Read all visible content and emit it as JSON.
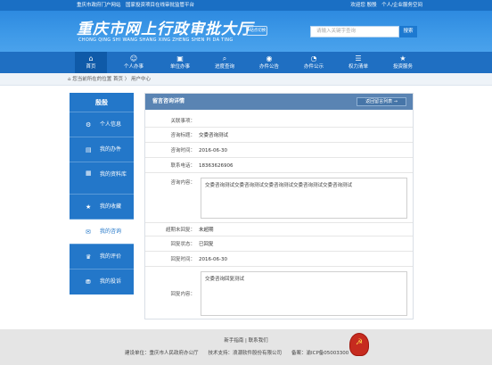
{
  "topbar": {
    "left_text": "重庆市政府门户网站　国家投资项目在线审批监管平台",
    "right_text": "欢迎您 殷殷　个人/企业服务空间"
  },
  "banner": {
    "title": "重庆市网上行政审批大厅",
    "subtitle": "CHONG QING SHI WANG SHANG XING ZHENG SHEN PI DA TING",
    "switch_label": "站点切换",
    "search_placeholder": "请输入关键字查询",
    "search_button": "搜索"
  },
  "nav": [
    {
      "label": "首页",
      "icon": "home-icon",
      "glyph": "⌂"
    },
    {
      "label": "个人办事",
      "icon": "person-icon",
      "glyph": "☺"
    },
    {
      "label": "单位办事",
      "icon": "briefcase-icon",
      "glyph": "▣"
    },
    {
      "label": "进度查询",
      "icon": "search-icon",
      "glyph": "⌕"
    },
    {
      "label": "办件公告",
      "icon": "announcement-icon",
      "glyph": "◉"
    },
    {
      "label": "办件公示",
      "icon": "chat-icon",
      "glyph": "◔"
    },
    {
      "label": "权力清单",
      "icon": "list-icon",
      "glyph": "☰"
    },
    {
      "label": "投资服务",
      "icon": "star-icon",
      "glyph": "★"
    }
  ],
  "breadcrumb": {
    "prefix": "您当前所在的位置",
    "path": "首页 〉 用户中心"
  },
  "sidebar": {
    "user": "殷殷",
    "items": [
      {
        "label": "个人信息",
        "icon": "gear-icon",
        "glyph": "⚙"
      },
      {
        "label": "我的办件",
        "icon": "document-icon",
        "glyph": "▤"
      },
      {
        "label": "我的资料库",
        "icon": "folder-icon",
        "glyph": "▦"
      },
      {
        "label": "我的收藏",
        "icon": "star-icon",
        "glyph": "★"
      },
      {
        "label": "我的咨询",
        "icon": "chat-icon",
        "glyph": "✉"
      },
      {
        "label": "我的评价",
        "icon": "trophy-icon",
        "glyph": "♛"
      },
      {
        "label": "我的投诉",
        "icon": "complaint-icon",
        "glyph": "⛃"
      }
    ]
  },
  "detail": {
    "title": "留言咨询详情",
    "back_button": "返回留言列表 →",
    "fields": {
      "related_k": "关联事项：",
      "related_v": "",
      "subject_k": "咨询标题：",
      "subject_v": "交委咨询测试",
      "time_k": "咨询时间：",
      "time_v": "2016-06-30",
      "phone_k": "联系电话：",
      "phone_v": "18363626906",
      "content_k": "咨询内容：",
      "content_v": "交委咨询测试交委咨询测试交委咨询测试交委咨询测试交委咨询测试",
      "overdue_k": "超期未回复：",
      "overdue_v": "未超期",
      "status_k": "回复状态：",
      "status_v": "已回复",
      "reply_time_k": "回复时间：",
      "reply_time_v": "2016-06-30",
      "reply_k": "回复内容：",
      "reply_v": "交委咨询回复测试"
    }
  },
  "footer": {
    "links": "新手指南 | 联系我们",
    "info": "建设单位：重庆市人民政府办公厅　　技术支持：浪潮软件股份有限公司　　备案：渝ICP备05003300"
  }
}
